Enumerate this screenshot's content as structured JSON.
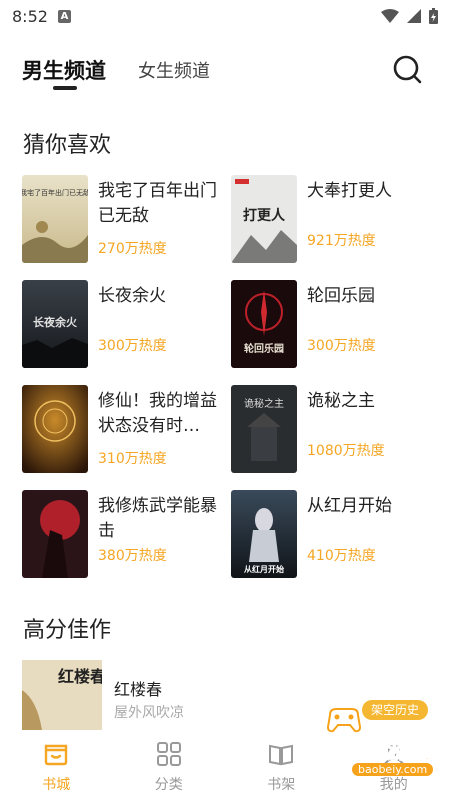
{
  "status_bar": {
    "time": "8:52",
    "notif_letter": "A"
  },
  "tabs": {
    "male": "男生频道",
    "female": "女生频道"
  },
  "sections": {
    "guess": "猜你喜欢",
    "high_score": "高分佳作"
  },
  "books": [
    {
      "title": "我宅了百年出门已无敌",
      "heat": "270万热度"
    },
    {
      "title": "大奉打更人",
      "heat": "921万热度"
    },
    {
      "title": "长夜余火",
      "heat": "300万热度"
    },
    {
      "title": "轮回乐园",
      "heat": "300万热度"
    },
    {
      "title": "修仙！我的增益状态没有时…",
      "heat": "310万热度"
    },
    {
      "title": "诡秘之主",
      "heat": "1080万热度"
    },
    {
      "title": "我修炼武学能暴击",
      "heat": "380万热度"
    },
    {
      "title": "从红月开始",
      "heat": "410万热度"
    }
  ],
  "cover_texts": {
    "c1": "我宅了百年出门已无敌",
    "c2": "打更人",
    "c3": "长夜余火",
    "c4": "轮回乐园",
    "c6": "诡秘之主",
    "c8": "从红月开始",
    "hs": "红楼春"
  },
  "high_score_book": {
    "title": "红楼春",
    "author": "屋外风吹凉"
  },
  "nav": [
    {
      "label": "书城"
    },
    {
      "label": "分类"
    },
    {
      "label": "书架"
    },
    {
      "label": "我的"
    }
  ],
  "history_badge": "架空历史",
  "watermark": {
    "text": "宝贝游戏网",
    "url": "baobeiy.com"
  },
  "colors": {
    "accent": "#f5a623",
    "text": "#222222",
    "muted": "#999999"
  }
}
